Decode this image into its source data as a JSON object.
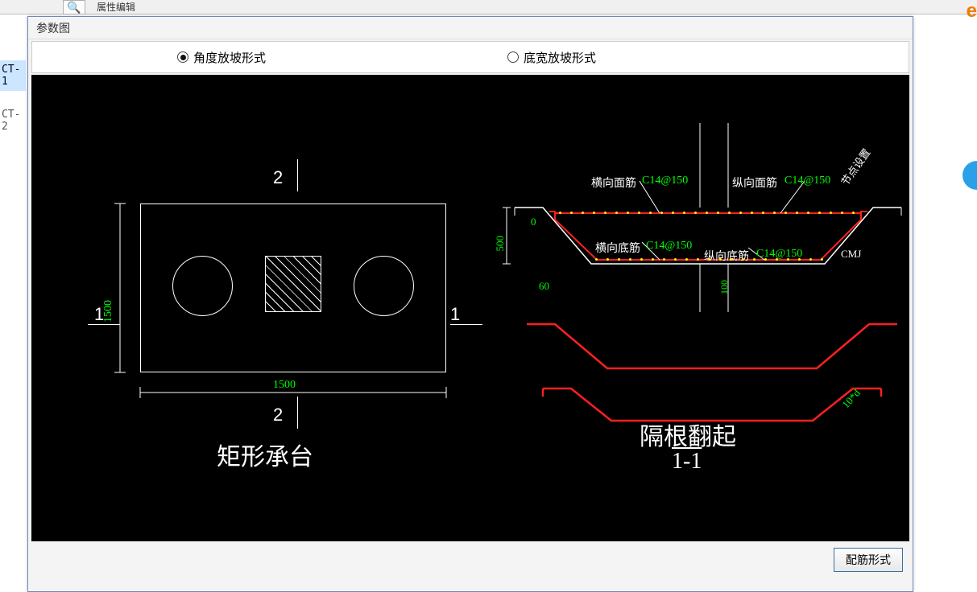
{
  "top": {
    "search_icon": "🔍",
    "label": "属性编辑"
  },
  "sidebar": {
    "items": [
      {
        "label": "CT-1",
        "selected": true
      },
      {
        "label": "CT-2",
        "selected": false
      }
    ]
  },
  "dialog": {
    "title": "参数图",
    "radios": {
      "angle": "角度放坡形式",
      "bottom": "底宽放坡形式",
      "selected": "angle"
    },
    "button": "配筋形式"
  },
  "drawing": {
    "left": {
      "title": "矩形承台",
      "width_dim": "1500",
      "height_dim": "1500",
      "section_top": "2",
      "section_bottom": "2",
      "section_left": "1",
      "section_right": "1"
    },
    "right": {
      "title_main": "隔根翻起",
      "title_sub": "1-1",
      "labels": {
        "hengxiang_mianjin": "横向面筋",
        "hengxiang_mianjin_val": "C14@150",
        "zongxiang_mianjin": "纵向面筋",
        "zongxiang_mianjin_val": "C14@150",
        "hengxiang_dijin": "横向底筋",
        "hengxiang_dijin_val": "C14@150",
        "zongxiang_dijin": "纵向底筋",
        "zongxiang_dijin_val": "C14@150",
        "cmj": "CMJ",
        "jiedian": "节点设置"
      },
      "dims": {
        "h_total": "500",
        "h_top": "0",
        "angle": "60",
        "col": "100",
        "ext": "10*d"
      }
    }
  },
  "colors": {
    "accent": "#2aa0e8",
    "cad_green": "#00ff00",
    "cad_red": "#ff2020",
    "cad_yellow": "#ffff00"
  }
}
